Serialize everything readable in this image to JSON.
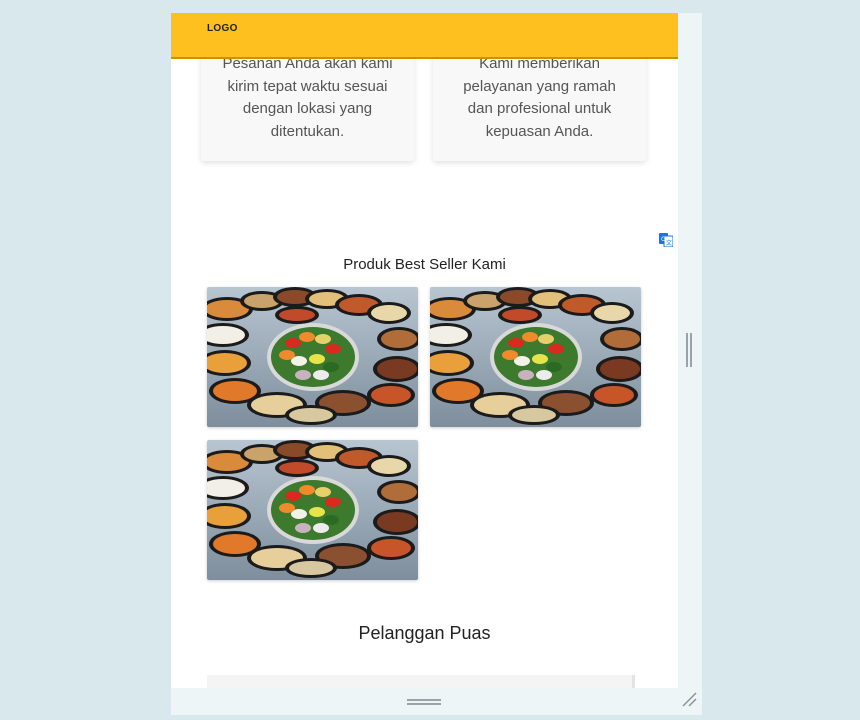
{
  "navbar": {
    "logo": "LOGO",
    "color": "#fec01f"
  },
  "features": [
    {
      "text": "Pesanan Anda akan kami kirim tepat waktu sesuai dengan lokasi yang ditentukan."
    },
    {
      "text": "Kami memberikan pelayanan yang ramah dan profesional untuk kepuasan Anda."
    }
  ],
  "best_seller": {
    "title": "Produk Best Seller Kami",
    "products": [
      {
        "image": "food-platter"
      },
      {
        "image": "food-platter"
      },
      {
        "image": "food-platter"
      }
    ]
  },
  "testimonials": {
    "title": "Pelanggan Puas"
  },
  "icons": {
    "translate": "translate-icon",
    "scroll_handle": "drag-handle-icon",
    "resize": "resize-grip-icon"
  }
}
